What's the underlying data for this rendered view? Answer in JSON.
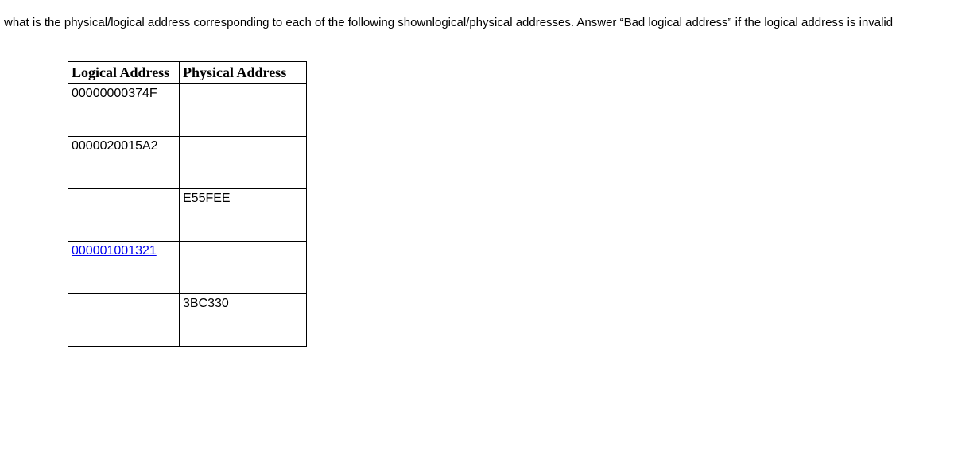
{
  "question": "what is the physical/logical address corresponding to each of the following shownlogical/physical addresses. Answer “Bad logical address” if the logical address is invalid",
  "headers": {
    "logical": "Logical Address",
    "physical": "Physical Address"
  },
  "rows": [
    {
      "logical": "00000000374F",
      "physical": ""
    },
    {
      "logical": "0000020015A2",
      "physical": ""
    },
    {
      "logical": "",
      "physical": "E55FEE"
    },
    {
      "logical": "000001001321",
      "physical": ""
    },
    {
      "logical": "",
      "physical": "3BC330"
    }
  ]
}
